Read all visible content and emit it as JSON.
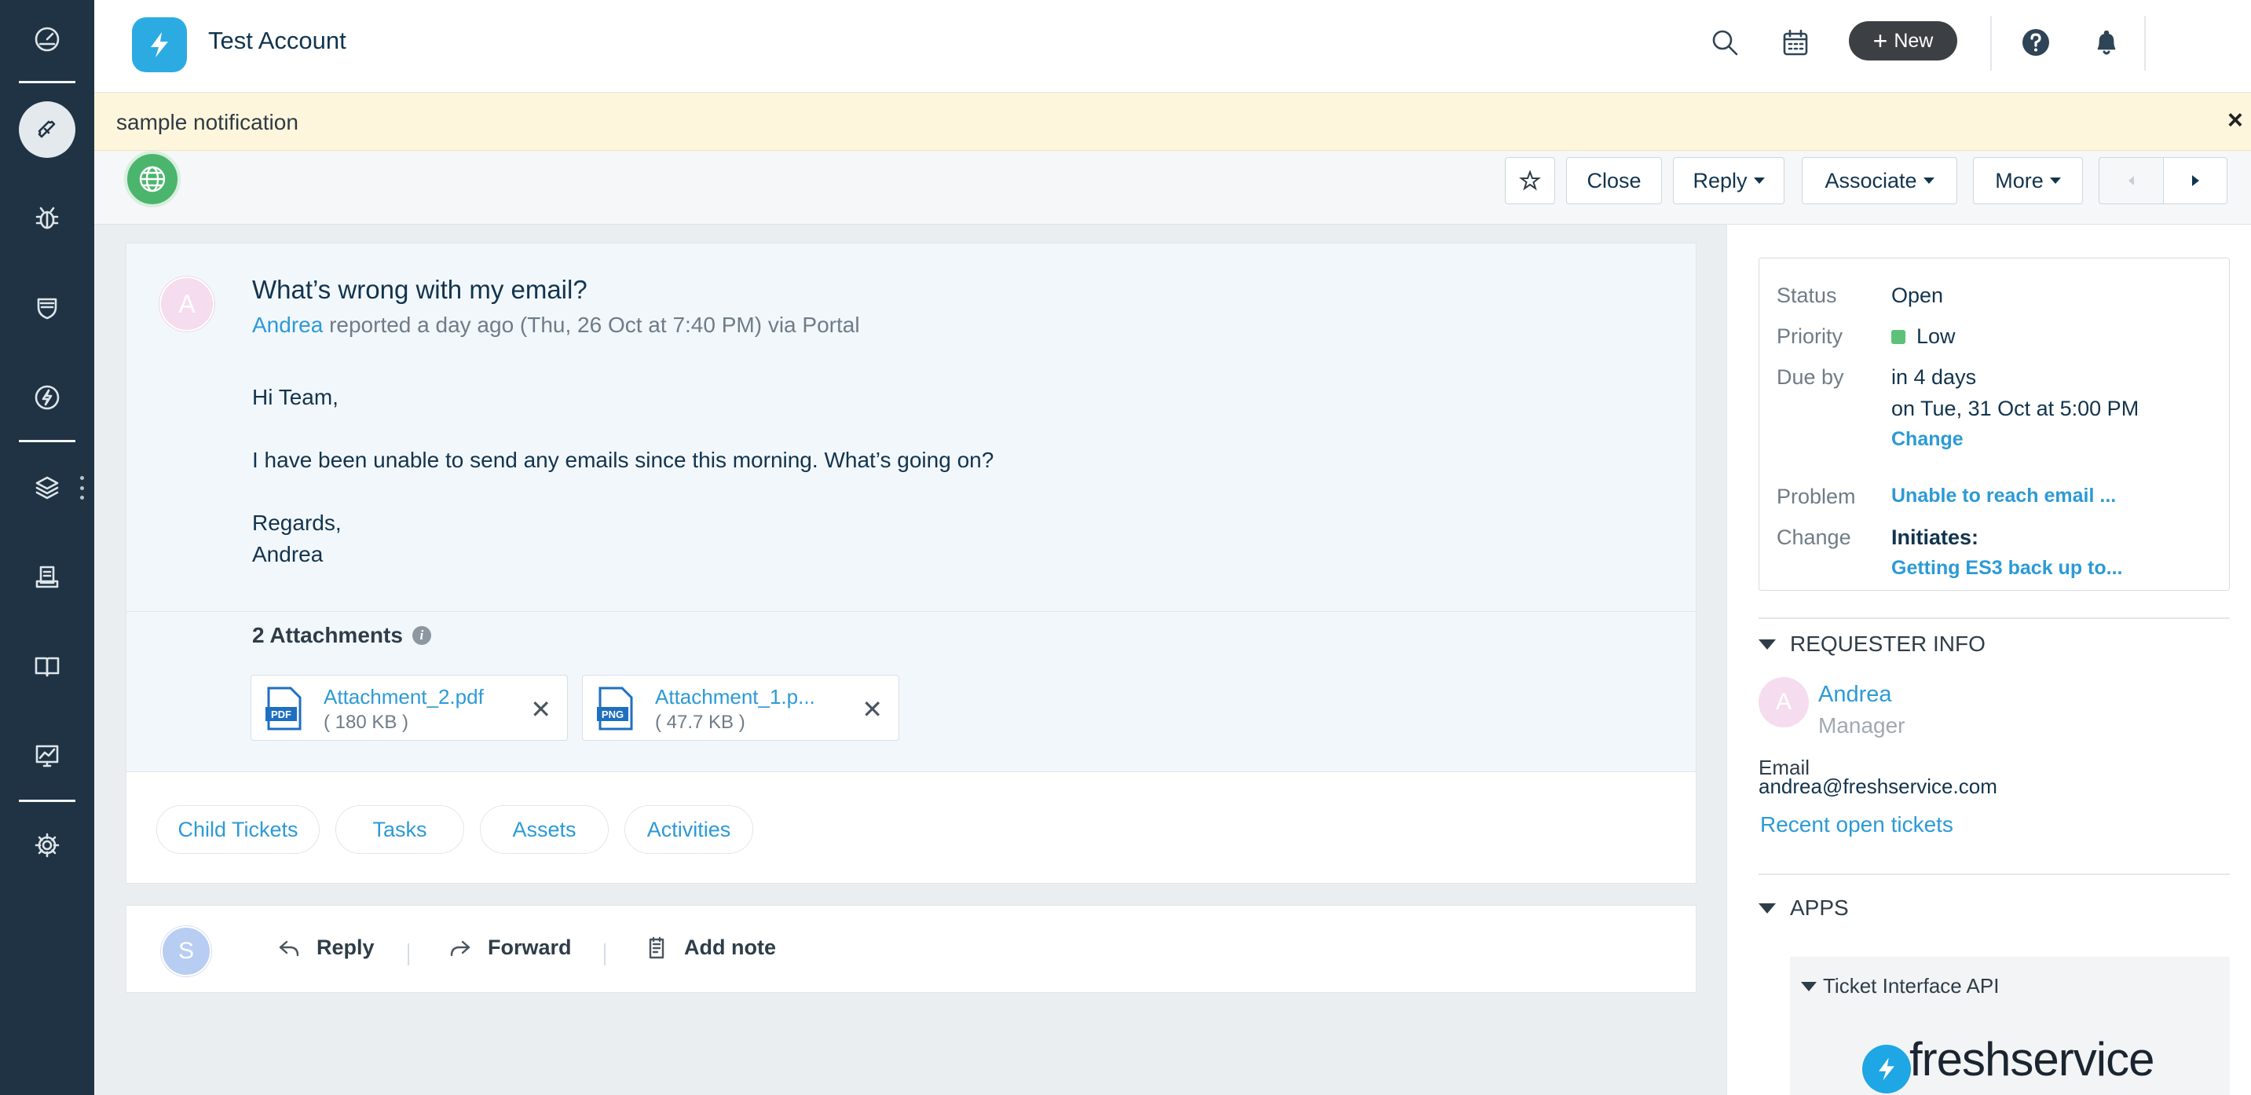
{
  "header": {
    "account_title": "Test Account",
    "new_button_label": "New",
    "user_initial": "S"
  },
  "notification": {
    "text": "sample notification",
    "close_glyph": "×"
  },
  "sidebar": {
    "items": [
      {
        "name": "dashboard-icon",
        "active": false
      },
      {
        "name": "tickets-icon",
        "active": true
      },
      {
        "name": "problems-icon",
        "active": false
      },
      {
        "name": "changes-icon",
        "active": false
      },
      {
        "name": "releases-icon",
        "active": false
      },
      {
        "name": "assets-icon",
        "active": false
      },
      {
        "name": "contracts-icon",
        "active": false
      },
      {
        "name": "solutions-icon",
        "active": false
      },
      {
        "name": "reports-icon",
        "active": false
      },
      {
        "name": "admin-icon",
        "active": false
      }
    ]
  },
  "actionbar": {
    "close_label": "Close",
    "reply_label": "Reply",
    "associate_label": "Associate",
    "more_label": "More"
  },
  "ticket": {
    "requester_initial": "A",
    "subject": "What’s wrong with my email?",
    "requester_name": "Andrea",
    "meta_rest": " reported a day ago (Thu, 26 Oct at 7:40 PM) via Portal",
    "body": {
      "greeting": "Hi Team,",
      "message": "I have been unable to send any emails since this morning. What’s going on?",
      "signoff": "Regards,",
      "signature": "Andrea"
    },
    "attachments_title": "2 Attachments",
    "attachments": [
      {
        "name": "Attachment_2.pdf",
        "size": "( 180 KB )",
        "type": "PDF"
      },
      {
        "name": "Attachment_1.p...",
        "size": "( 47.7 KB )",
        "type": "PNG"
      }
    ],
    "tabs": [
      "Child Tickets",
      "Tasks",
      "Assets",
      "Activities"
    ]
  },
  "reply_bar": {
    "agent_initial": "S",
    "reply_label": "Reply",
    "forward_label": "Forward",
    "note_label": "Add note"
  },
  "properties": {
    "status_label": "Status",
    "status_value": "Open",
    "priority_label": "Priority",
    "priority_value": "Low",
    "priority_color": "#5cc27a",
    "due_label": "Due by",
    "due_relative": "in 4 days",
    "due_date": "on Tue, 31 Oct at 5:00 PM",
    "due_change_link": "Change",
    "problem_label": "Problem",
    "problem_value": "Unable to reach email ...",
    "change_label": "Change",
    "change_prefix": "Initiates:",
    "change_value": "Getting ES3 back up to..."
  },
  "requester_info": {
    "section_title": "REQUESTER INFO",
    "initial": "A",
    "name": "Andrea",
    "role": "Manager",
    "email_label": "Email",
    "email": "andrea@freshservice.com",
    "recent_link": "Recent open tickets"
  },
  "apps": {
    "section_title": "APPS",
    "app_name": "Ticket Interface API",
    "brand_text": "freshservice"
  },
  "colors": {
    "sidebar_bg": "#1f3344",
    "accent_link": "#2c9ad6",
    "brand": "#2cabe3",
    "notification_bg": "#fdf6dc"
  }
}
